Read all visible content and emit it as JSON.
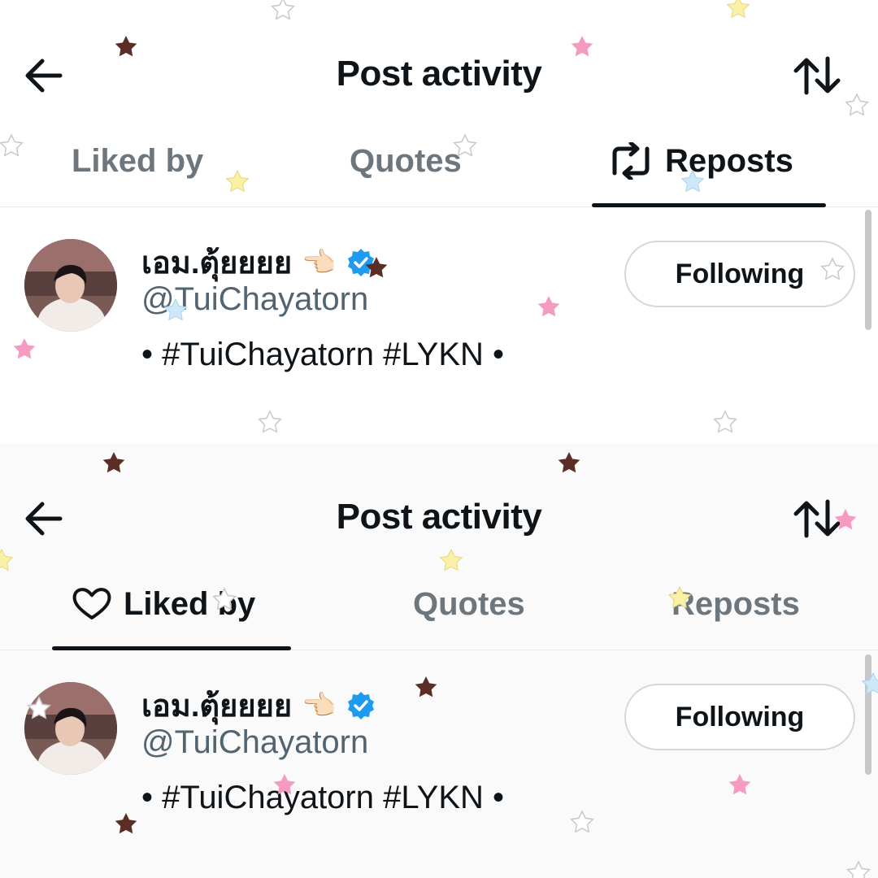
{
  "colors": {
    "text": "#0f1419",
    "muted": "#536471",
    "tab_inactive": "#6e767d",
    "verified": "#1d9bf0",
    "star_brown": "#5b2d24",
    "star_pink": "#f59ac1",
    "star_yellow": "#fbf0a8",
    "star_blue": "#cfe8f8",
    "star_white": "#ffffff"
  },
  "panels": [
    {
      "header": {
        "title": "Post activity",
        "back_icon": "arrow-left-icon",
        "sort_icon": "sort-arrows-icon"
      },
      "tabs": [
        {
          "label": "Liked by",
          "active": false
        },
        {
          "label": "Quotes",
          "active": false
        },
        {
          "label": "Reposts",
          "active": true,
          "icon": "repost-icon"
        }
      ],
      "user": {
        "display_name": "เอม.ตุ้ยยยย",
        "emoji": "👈🏻",
        "verified_icon": "verified-badge-icon",
        "handle": "@TuiChayatorn",
        "bio": "• #TuiChayatorn #LYKN •",
        "follow_label": "Following"
      }
    },
    {
      "header": {
        "title": "Post activity",
        "back_icon": "arrow-left-icon",
        "sort_icon": "sort-arrows-icon"
      },
      "tabs": [
        {
          "label": "Liked by",
          "active": true,
          "icon": "heart-icon"
        },
        {
          "label": "Quotes",
          "active": false
        },
        {
          "label": "Reposts",
          "active": false
        }
      ],
      "user": {
        "display_name": "เอม.ตุ้ยยยย",
        "emoji": "👈🏻",
        "verified_icon": "verified-badge-icon",
        "handle": "@TuiChayatorn",
        "bio": "• #TuiChayatorn #LYKN •",
        "follow_label": "Following"
      }
    }
  ]
}
